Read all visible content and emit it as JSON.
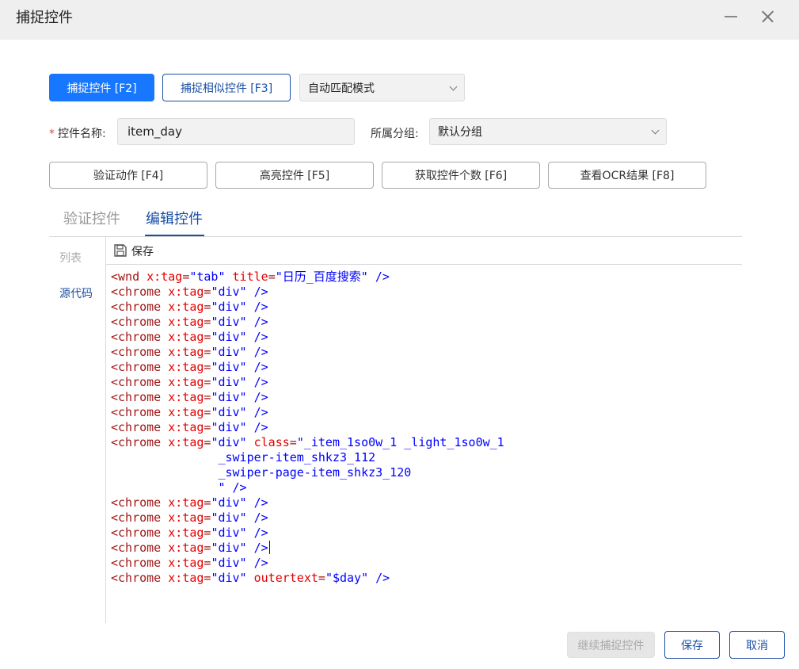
{
  "window": {
    "title": "捕捉控件"
  },
  "toolbar": {
    "capture_label": "捕捉控件 [F2]",
    "capture_similar_label": "捕捉相似控件 [F3]",
    "match_mode": {
      "value": "自动匹配模式"
    }
  },
  "form": {
    "name_label": "控件名称:",
    "required_mark": "*",
    "name_value": "item_day",
    "group_label": "所属分组:",
    "group_value": "默认分组"
  },
  "actions": {
    "verify_action": "验证动作 [F4]",
    "highlight": "高亮控件 [F5]",
    "count": "获取控件个数 [F6]",
    "ocr": "查看OCR结果 [F8]"
  },
  "tabs": {
    "verify": "验证控件",
    "edit": "编辑控件",
    "active": "edit"
  },
  "sidebar": {
    "list": "列表",
    "source": "源代码",
    "active": "source"
  },
  "editor": {
    "save_label": "保存",
    "lines": [
      [
        {
          "t": "<wnd ",
          "c": "tg"
        },
        {
          "t": "x:tag",
          "c": "at"
        },
        {
          "t": "=",
          "c": "tg"
        },
        {
          "t": "\"tab\"",
          "c": "av"
        },
        {
          "t": " ",
          "c": "tg"
        },
        {
          "t": "title",
          "c": "at"
        },
        {
          "t": "=",
          "c": "tg"
        },
        {
          "t": "\"日历_百度搜索\"",
          "c": "av"
        },
        {
          "t": " />",
          "c": "av"
        }
      ],
      [
        {
          "t": "<chrome ",
          "c": "tg"
        },
        {
          "t": "x:tag",
          "c": "at"
        },
        {
          "t": "=",
          "c": "tg"
        },
        {
          "t": "\"div\"",
          "c": "av"
        },
        {
          "t": " />",
          "c": "av"
        }
      ],
      [
        {
          "t": "<chrome ",
          "c": "tg"
        },
        {
          "t": "x:tag",
          "c": "at"
        },
        {
          "t": "=",
          "c": "tg"
        },
        {
          "t": "\"div\"",
          "c": "av"
        },
        {
          "t": " />",
          "c": "av"
        }
      ],
      [
        {
          "t": "<chrome ",
          "c": "tg"
        },
        {
          "t": "x:tag",
          "c": "at"
        },
        {
          "t": "=",
          "c": "tg"
        },
        {
          "t": "\"div\"",
          "c": "av"
        },
        {
          "t": " />",
          "c": "av"
        }
      ],
      [
        {
          "t": "<chrome ",
          "c": "tg"
        },
        {
          "t": "x:tag",
          "c": "at"
        },
        {
          "t": "=",
          "c": "tg"
        },
        {
          "t": "\"div\"",
          "c": "av"
        },
        {
          "t": " />",
          "c": "av"
        }
      ],
      [
        {
          "t": "<chrome ",
          "c": "tg"
        },
        {
          "t": "x:tag",
          "c": "at"
        },
        {
          "t": "=",
          "c": "tg"
        },
        {
          "t": "\"div\"",
          "c": "av"
        },
        {
          "t": " />",
          "c": "av"
        }
      ],
      [
        {
          "t": "<chrome ",
          "c": "tg"
        },
        {
          "t": "x:tag",
          "c": "at"
        },
        {
          "t": "=",
          "c": "tg"
        },
        {
          "t": "\"div\"",
          "c": "av"
        },
        {
          "t": " />",
          "c": "av"
        }
      ],
      [
        {
          "t": "<chrome ",
          "c": "tg"
        },
        {
          "t": "x:tag",
          "c": "at"
        },
        {
          "t": "=",
          "c": "tg"
        },
        {
          "t": "\"div\"",
          "c": "av"
        },
        {
          "t": " />",
          "c": "av"
        }
      ],
      [
        {
          "t": "<chrome ",
          "c": "tg"
        },
        {
          "t": "x:tag",
          "c": "at"
        },
        {
          "t": "=",
          "c": "tg"
        },
        {
          "t": "\"div\"",
          "c": "av"
        },
        {
          "t": " />",
          "c": "av"
        }
      ],
      [
        {
          "t": "<chrome ",
          "c": "tg"
        },
        {
          "t": "x:tag",
          "c": "at"
        },
        {
          "t": "=",
          "c": "tg"
        },
        {
          "t": "\"div\"",
          "c": "av"
        },
        {
          "t": " />",
          "c": "av"
        }
      ],
      [
        {
          "t": "<chrome ",
          "c": "tg"
        },
        {
          "t": "x:tag",
          "c": "at"
        },
        {
          "t": "=",
          "c": "tg"
        },
        {
          "t": "\"div\"",
          "c": "av"
        },
        {
          "t": " />",
          "c": "av"
        }
      ],
      [
        {
          "t": "<chrome ",
          "c": "tg"
        },
        {
          "t": "x:tag",
          "c": "at"
        },
        {
          "t": "=",
          "c": "tg"
        },
        {
          "t": "\"div\"",
          "c": "av"
        },
        {
          "t": " ",
          "c": "tg"
        },
        {
          "t": "class",
          "c": "at"
        },
        {
          "t": "=",
          "c": "tg"
        },
        {
          "t": "\"_item_1so0w_1 _light_1so0w_1",
          "c": "av"
        }
      ],
      [
        {
          "t": "               _swiper-item_shkz3_112",
          "c": "av"
        }
      ],
      [
        {
          "t": "               _swiper-page-item_shkz3_120",
          "c": "av"
        }
      ],
      [
        {
          "t": "               \" />",
          "c": "av"
        }
      ],
      [
        {
          "t": "<chrome ",
          "c": "tg"
        },
        {
          "t": "x:tag",
          "c": "at"
        },
        {
          "t": "=",
          "c": "tg"
        },
        {
          "t": "\"div\"",
          "c": "av"
        },
        {
          "t": " />",
          "c": "av"
        }
      ],
      [
        {
          "t": "<chrome ",
          "c": "tg"
        },
        {
          "t": "x:tag",
          "c": "at"
        },
        {
          "t": "=",
          "c": "tg"
        },
        {
          "t": "\"div\"",
          "c": "av"
        },
        {
          "t": " />",
          "c": "av"
        }
      ],
      [
        {
          "t": "<chrome ",
          "c": "tg"
        },
        {
          "t": "x:tag",
          "c": "at"
        },
        {
          "t": "=",
          "c": "tg"
        },
        {
          "t": "\"div\"",
          "c": "av"
        },
        {
          "t": " />",
          "c": "av"
        }
      ],
      [
        {
          "t": "<chrome ",
          "c": "tg"
        },
        {
          "t": "x:tag",
          "c": "at"
        },
        {
          "t": "=",
          "c": "tg"
        },
        {
          "t": "\"div\"",
          "c": "av"
        },
        {
          "t": " />",
          "c": "av"
        },
        {
          "t": "",
          "c": "caret"
        }
      ],
      [
        {
          "t": "<chrome ",
          "c": "tg"
        },
        {
          "t": "x:tag",
          "c": "at"
        },
        {
          "t": "=",
          "c": "tg"
        },
        {
          "t": "\"div\"",
          "c": "av"
        },
        {
          "t": " />",
          "c": "av"
        }
      ],
      [
        {
          "t": "<chrome ",
          "c": "tg"
        },
        {
          "t": "x:tag",
          "c": "at"
        },
        {
          "t": "=",
          "c": "tg"
        },
        {
          "t": "\"div\"",
          "c": "av"
        },
        {
          "t": " ",
          "c": "tg"
        },
        {
          "t": "outertext",
          "c": "at"
        },
        {
          "t": "=",
          "c": "tg"
        },
        {
          "t": "\"$day\"",
          "c": "av"
        },
        {
          "t": " />",
          "c": "av"
        }
      ]
    ]
  },
  "footer": {
    "continue_label": "继续捕捉控件",
    "save_label": "保存",
    "cancel_label": "取消"
  }
}
